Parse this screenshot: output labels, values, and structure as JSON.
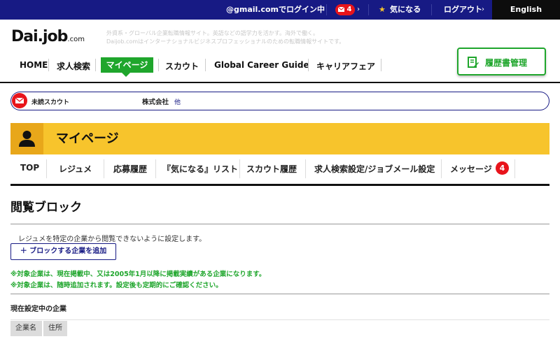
{
  "topbar": {
    "login_text": "@gmail.comでログイン中",
    "mail_count": "4",
    "favorites_label": "気になる",
    "logout_label": "ログアウト",
    "english_label": "English"
  },
  "header": {
    "logo_text": "Dai.job",
    "logo_suffix": ".com",
    "tagline1": "外資系・グローバル企業転職情報サイト。英語などの語学力を活かす。海外で働く。",
    "tagline2": "Daijob.comはインターナショナルビジネスプロフェッショナルのための転職情報サイトです。"
  },
  "nav": {
    "items": [
      "HOME",
      "求人検索",
      "マイページ",
      "スカウト",
      "Global Career Guide",
      "キャリアフェア"
    ],
    "resume_button": "履歴書管理"
  },
  "scout": {
    "label": "未読スカウト",
    "company": "株式会社",
    "other": "他"
  },
  "mypage": {
    "title": "マイページ",
    "tabs": [
      "TOP",
      "レジュメ",
      "応募履歴",
      "『気になる』リスト",
      "スカウト履歴",
      "求人検索設定/ジョブメール設定",
      "メッセージ"
    ],
    "message_count": "4"
  },
  "main": {
    "title": "閲覧ブロック",
    "description": "レジュメを特定の企業から閲覧できないように設定します。",
    "add_button": "＋ ブロックする企業を追加",
    "notes": [
      "※対象企業は、現在掲載中、又は2005年1月以降に掲載実績がある企業になります。",
      "※対象企業は、随時追加されます。設定後も定期的にご確認ください。"
    ],
    "current_label": "現在設定中の企業",
    "table_headers": [
      "企業名",
      "住所"
    ]
  },
  "colors": {
    "navy": "#171a84",
    "green": "#1fa62c",
    "red": "#e8141b",
    "yellow": "#f7c42c"
  }
}
